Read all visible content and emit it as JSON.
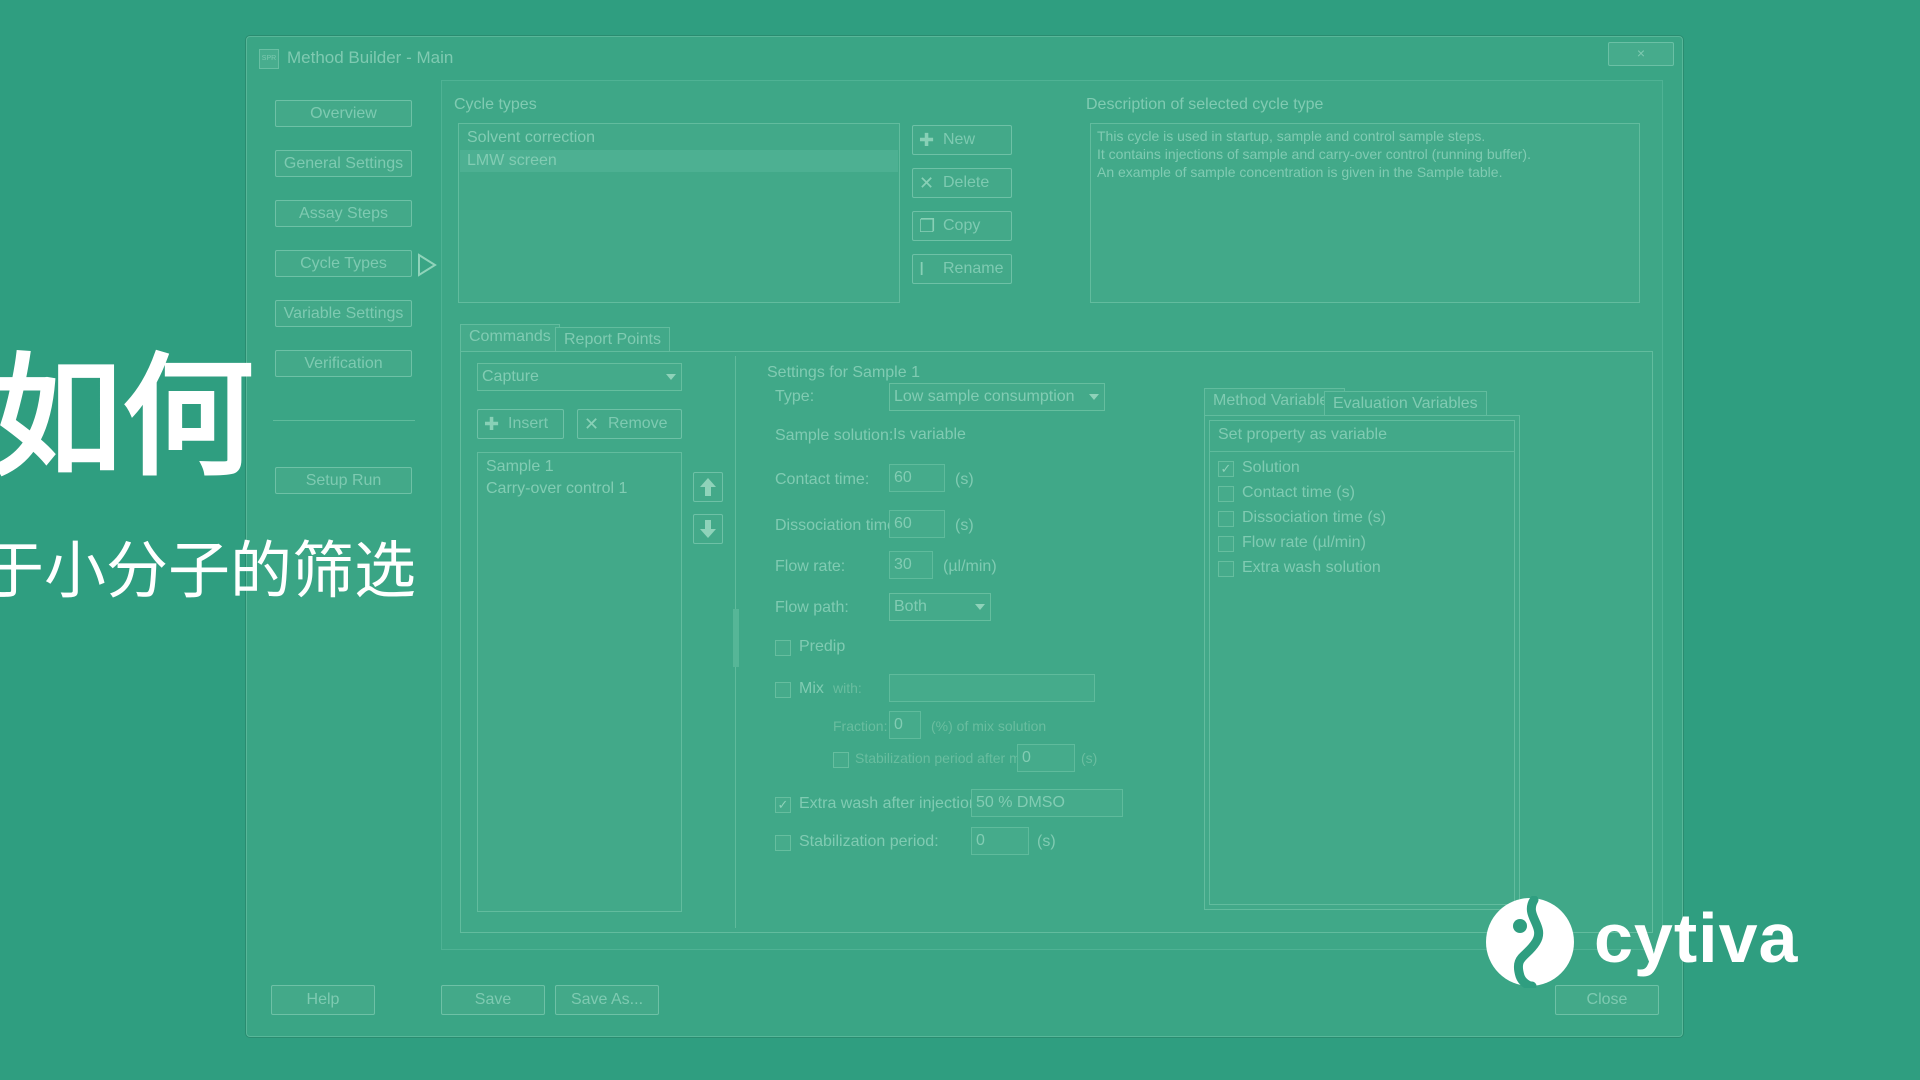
{
  "window": {
    "title": "Method Builder - Main",
    "close_label": "×"
  },
  "nav": {
    "items": [
      "Overview",
      "General Settings",
      "Assay Steps",
      "Cycle Types",
      "Variable Settings",
      "Verification"
    ],
    "setup_run": "Setup Run"
  },
  "cycle_types": {
    "label": "Cycle types",
    "items": [
      "Solvent correction",
      "LMW screen"
    ],
    "buttons": {
      "new": "New",
      "delete": "Delete",
      "copy": "Copy",
      "rename": "Rename"
    }
  },
  "description": {
    "label": "Description of selected cycle type",
    "lines": [
      "This cycle is used in startup, sample and control sample steps.",
      "It contains injections of sample and carry-over control (running buffer).",
      "An example of sample concentration is given in the Sample table."
    ]
  },
  "tabs": [
    "Commands",
    "Report Points"
  ],
  "commands": {
    "combo_value": "Capture",
    "insert": "Insert",
    "remove": "Remove",
    "items": [
      "Sample 1",
      "Carry-over control 1"
    ]
  },
  "settings": {
    "title": "Settings for Sample 1",
    "type_label": "Type:",
    "type_value": "Low sample consumption",
    "sample_solution_label": "Sample solution:",
    "sample_solution_value": "Is variable",
    "contact_time_label": "Contact time:",
    "contact_time_value": "60",
    "contact_time_unit": "(s)",
    "dissociation_time_label": "Dissociation time:",
    "dissociation_time_value": "60",
    "dissociation_time_unit": "(s)",
    "flow_rate_label": "Flow rate:",
    "flow_rate_value": "30",
    "flow_rate_unit": "(µl/min)",
    "flow_path_label": "Flow path:",
    "flow_path_value": "Both",
    "predip_label": "Predip",
    "mix_label": "Mix",
    "mix_with_label": "with:",
    "fraction_label": "Fraction:",
    "fraction_value": "0",
    "fraction_unit": "(%) of mix solution",
    "stab_after_mix_label": "Stabilization period after mix:",
    "stab_after_mix_value": "0",
    "stab_after_mix_unit": "(s)",
    "extra_wash_label": "Extra wash after injection with:",
    "extra_wash_value": "50 % DMSO",
    "stab_label": "Stabilization period:",
    "stab_value": "0",
    "stab_unit": "(s)"
  },
  "variables": {
    "tabs": [
      "Method Variables",
      "Evaluation Variables"
    ],
    "header": "Set property as variable",
    "items": [
      {
        "label": "Solution",
        "checked": true
      },
      {
        "label": "Contact time (s)",
        "checked": false
      },
      {
        "label": "Dissociation time (s)",
        "checked": false
      },
      {
        "label": "Flow rate (µl/min)",
        "checked": false
      },
      {
        "label": "Extra wash solution",
        "checked": false
      }
    ]
  },
  "footer": {
    "help": "Help",
    "save": "Save",
    "save_as": "Save As...",
    "close": "Close"
  },
  "overlay": {
    "title": "如何",
    "subtitle": "于小分子的筛选"
  },
  "brand": {
    "name": "cytiva",
    "color": "#ffffff"
  },
  "colors": {
    "background": "#2f9e80",
    "overlay_text": "#ffffff"
  }
}
